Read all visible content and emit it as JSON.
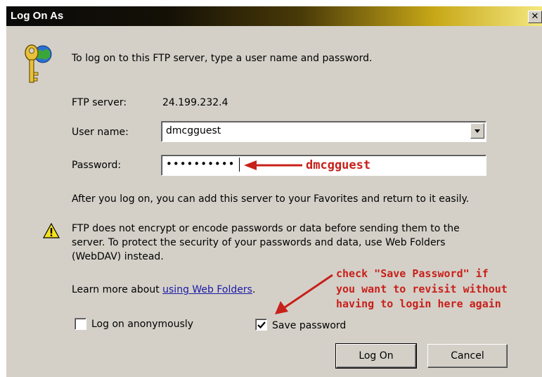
{
  "window": {
    "title": "Log On As",
    "close_glyph": "✕"
  },
  "intro": "To log on to this FTP server, type a user name and password.",
  "fields": {
    "ftp_server_label": "FTP server:",
    "ftp_server_value": "24.199.232.4",
    "user_name_label": "User name:",
    "user_name_value": "dmcgguest",
    "password_label": "Password:",
    "password_mask": "••••••••••"
  },
  "favorites_note": "After you log on, you can add this server to your Favorites and return to it easily.",
  "warning": {
    "line1": "FTP does not encrypt or encode passwords or data before sending them to the",
    "line2": "server.  To protect the security of your passwords and data, use Web Folders",
    "line3": "(WebDAV) instead."
  },
  "learn_more": {
    "prefix": "Learn more about ",
    "link": "using Web Folders",
    "suffix": "."
  },
  "checkboxes": {
    "anonymous_label": "Log on anonymously",
    "anonymous_checked": false,
    "save_password_label": "Save password",
    "save_password_checked": true
  },
  "buttons": {
    "log_on": "Log On",
    "cancel": "Cancel"
  },
  "annotations": {
    "password_hint": "dmcgguest",
    "save_hint_line1": "check \"Save Password\" if",
    "save_hint_line2": "you want to revisit without",
    "save_hint_line3": "having to login here again",
    "color": "#c8201a"
  }
}
